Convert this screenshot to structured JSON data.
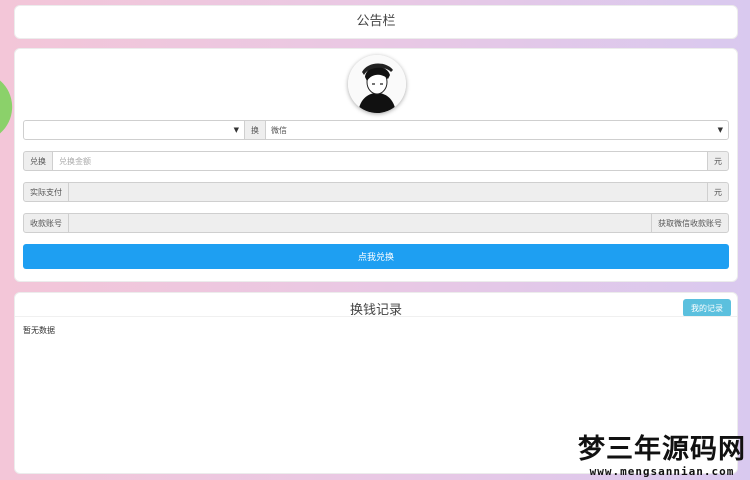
{
  "notice": {
    "title": "公告栏"
  },
  "exchange": {
    "avatar_icon": "user-avatar-icon",
    "method_label": "换",
    "source_select": {
      "value": ""
    },
    "method_select": {
      "value": "微信"
    },
    "amount": {
      "label": "兑换",
      "placeholder": "兑换金额",
      "unit": "元"
    },
    "actual_pay": {
      "label": "实际支付",
      "value": "",
      "unit": "元"
    },
    "account": {
      "label": "收款账号",
      "value": "",
      "action": "获取微信收款账号"
    },
    "submit_label": "点我兑换"
  },
  "records": {
    "title": "换钱记录",
    "my_records_label": "我的记录",
    "empty_text": "暂无数据"
  },
  "watermark": {
    "title": "梦三年源码网",
    "url": "www.mengsannian.com"
  }
}
